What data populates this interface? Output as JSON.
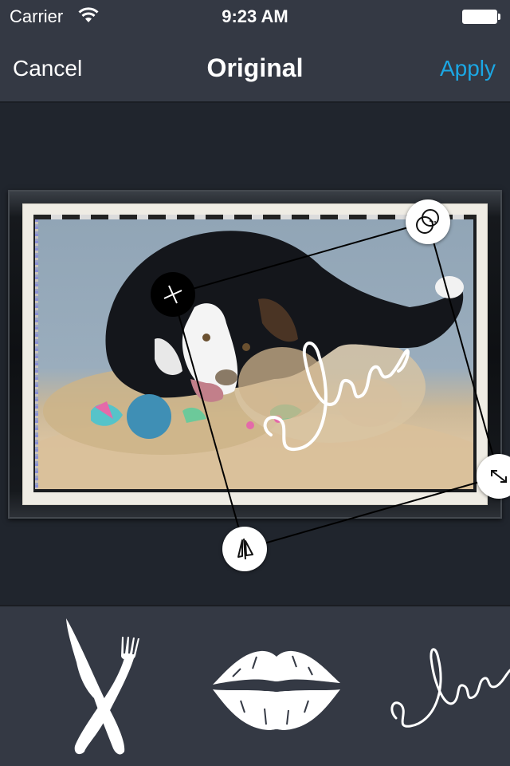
{
  "status_bar": {
    "carrier": "Carrier",
    "time": "9:23 AM",
    "wifi_icon": "wifi-icon",
    "battery_icon": "battery-icon"
  },
  "nav_bar": {
    "cancel_label": "Cancel",
    "title": "Original",
    "apply_label": "Apply",
    "apply_color": "#1ba7e4"
  },
  "editor": {
    "photo_description": "Black and white dog playing in sand with a colorful rope toy",
    "frame_style": "black wooden frame with cream mat",
    "overlay_sticker": {
      "name": "love",
      "text": "love"
    },
    "handles": [
      {
        "name": "delete-handle",
        "icon": "close-icon"
      },
      {
        "name": "opacity-handle",
        "icon": "overlap-circles-icon"
      },
      {
        "name": "resize-rotate-handle",
        "icon": "diagonal-arrows-icon"
      },
      {
        "name": "flip-handle",
        "icon": "mirror-flip-icon"
      }
    ]
  },
  "sticker_tray": {
    "items": [
      {
        "name": "knife-fork",
        "icon": "knife-fork-icon"
      },
      {
        "name": "lips",
        "icon": "lips-icon"
      },
      {
        "name": "love-script",
        "icon": "love-script-icon",
        "text": "love"
      }
    ]
  },
  "colors": {
    "nav_background": "#343944",
    "canvas_background": "#20252d",
    "accent": "#1ba7e4"
  }
}
